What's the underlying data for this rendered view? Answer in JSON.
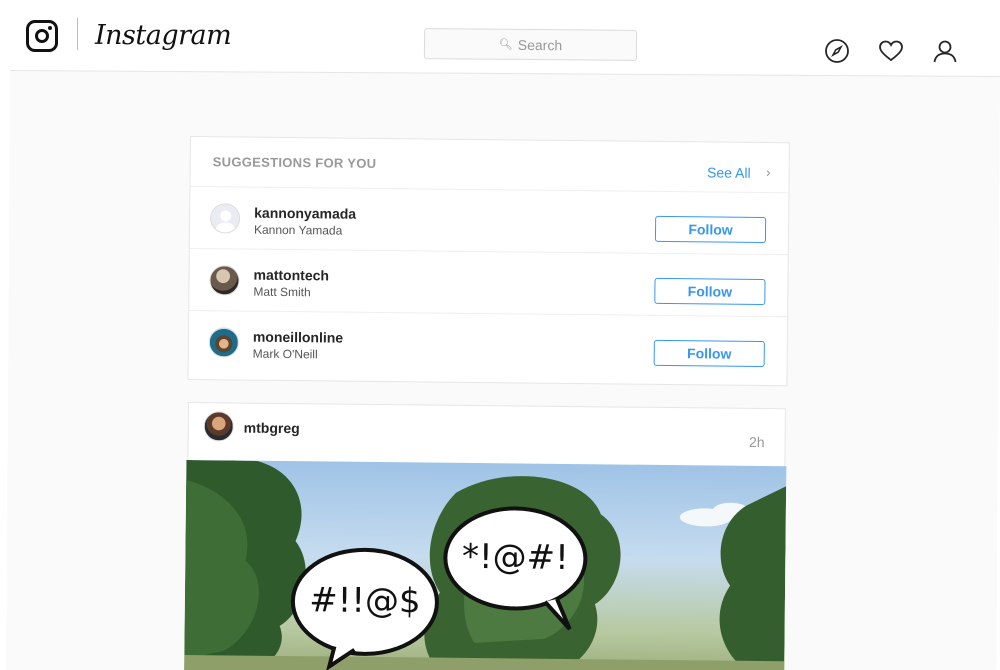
{
  "header": {
    "wordmark": "Instagram",
    "search_placeholder": "Search",
    "icons": [
      "compass-icon",
      "heart-icon",
      "profile-icon"
    ]
  },
  "suggestions": {
    "title": "SUGGESTIONS FOR YOU",
    "see_all": "See All",
    "follow_label": "Follow",
    "items": [
      {
        "username": "kannonyamada",
        "name": "Kannon Yamada"
      },
      {
        "username": "mattontech",
        "name": "Matt Smith"
      },
      {
        "username": "moneillonline",
        "name": "Mark O'Neill"
      }
    ]
  },
  "post": {
    "username": "mtbgreg",
    "time": "2h",
    "bubbles": [
      "#!!@$",
      "*!@#!"
    ]
  },
  "colors": {
    "accent": "#3897f0",
    "muted": "#999999",
    "background": "#fafafa"
  }
}
